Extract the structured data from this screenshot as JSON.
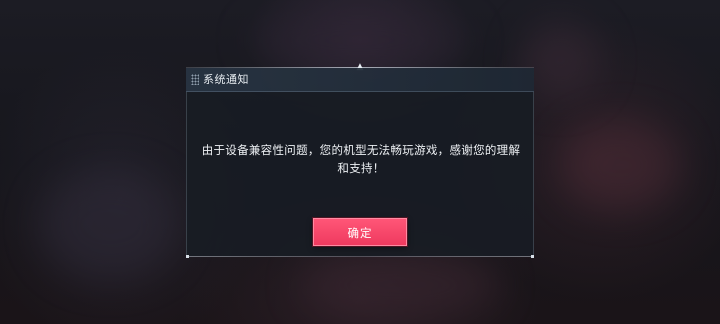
{
  "dialog": {
    "title": "系统通知",
    "message": "由于设备兼容性问题，您的机型无法畅玩游戏，感谢您的理解和支持！",
    "confirm_label": "确定"
  },
  "icons": {
    "grip": "grip-dots-icon",
    "top_marker": "arrow-up-marker-icon"
  },
  "colors": {
    "confirm_button": "#ef3a5f",
    "title_bar": "#28344a",
    "body_panel": "#181c24"
  }
}
